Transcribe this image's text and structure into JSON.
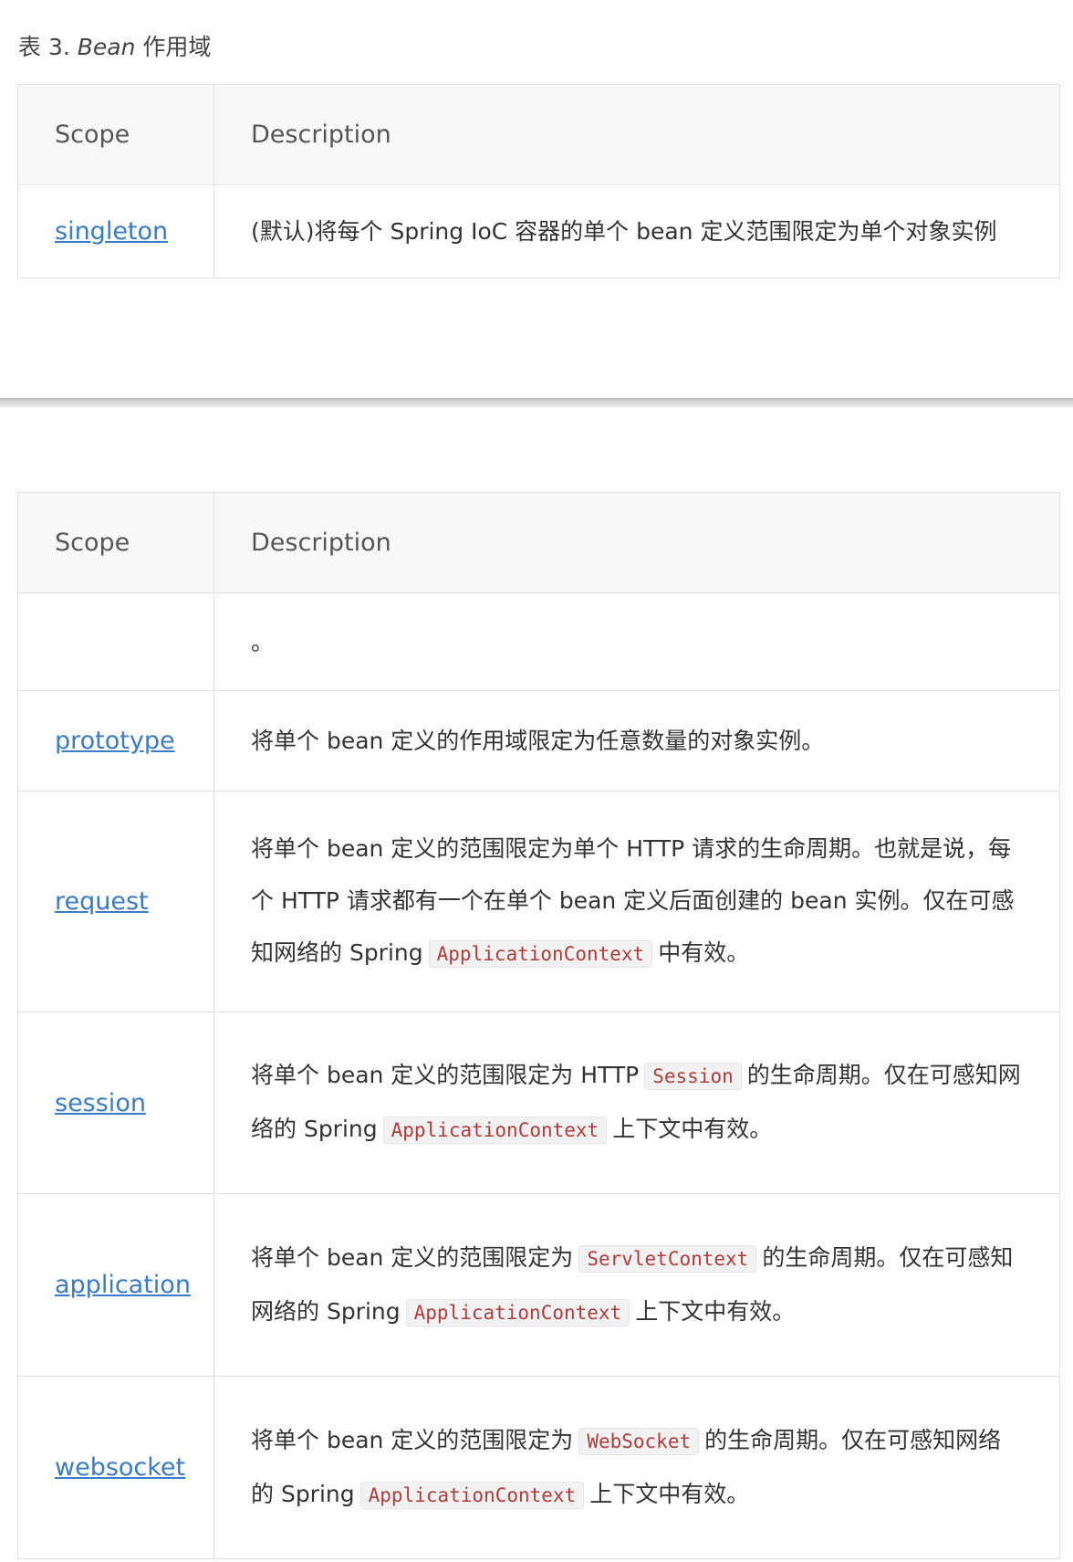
{
  "caption": {
    "prefix": "表 3. ",
    "em": "Bean",
    "suffix": " 作用域"
  },
  "table1": {
    "headers": {
      "scope": "Scope",
      "description": "Description"
    },
    "rows": [
      {
        "scope": "singleton",
        "description": "(默认)将每个 Spring IoC 容器的单个 bean 定义范围限定为单个对象实例"
      }
    ]
  },
  "table2": {
    "headers": {
      "scope": "Scope",
      "description": "Description"
    },
    "rows": [
      {
        "scope": "",
        "description": "。"
      },
      {
        "scope": "prototype",
        "description": "将单个 bean 定义的作用域限定为任意数量的对象实例。"
      },
      {
        "scope": "request",
        "d1": "将单个 bean 定义的范围限定为单个 HTTP 请求的生命周期。也就是说，每个 HTTP 请求都有一个在单个 bean 定义后面创建的 bean 实例。仅在可感知网络的 Spring",
        "code1": "ApplicationContext",
        "d2": "中有效。"
      },
      {
        "scope": "session",
        "d1": "将单个 bean 定义的范围限定为 HTTP",
        "code1": "Session",
        "d2": "的生命周期。仅在可感知网络的 Spring",
        "code2": "ApplicationContext",
        "d3": "上下文中有效。"
      },
      {
        "scope": "application",
        "d1": "将单个 bean 定义的范围限定为",
        "code1": "ServletContext",
        "d2": "的生命周期。仅在可感知网络的 Spring",
        "code2": "ApplicationContext",
        "d3": "上下文中有效。"
      },
      {
        "scope": "websocket",
        "d1": "将单个 bean 定义的范围限定为",
        "code1": "WebSocket",
        "d2": "的生命周期。仅在可感知网络的 Spring",
        "code2": "ApplicationContext",
        "d3": "上下文中有效。"
      }
    ]
  }
}
